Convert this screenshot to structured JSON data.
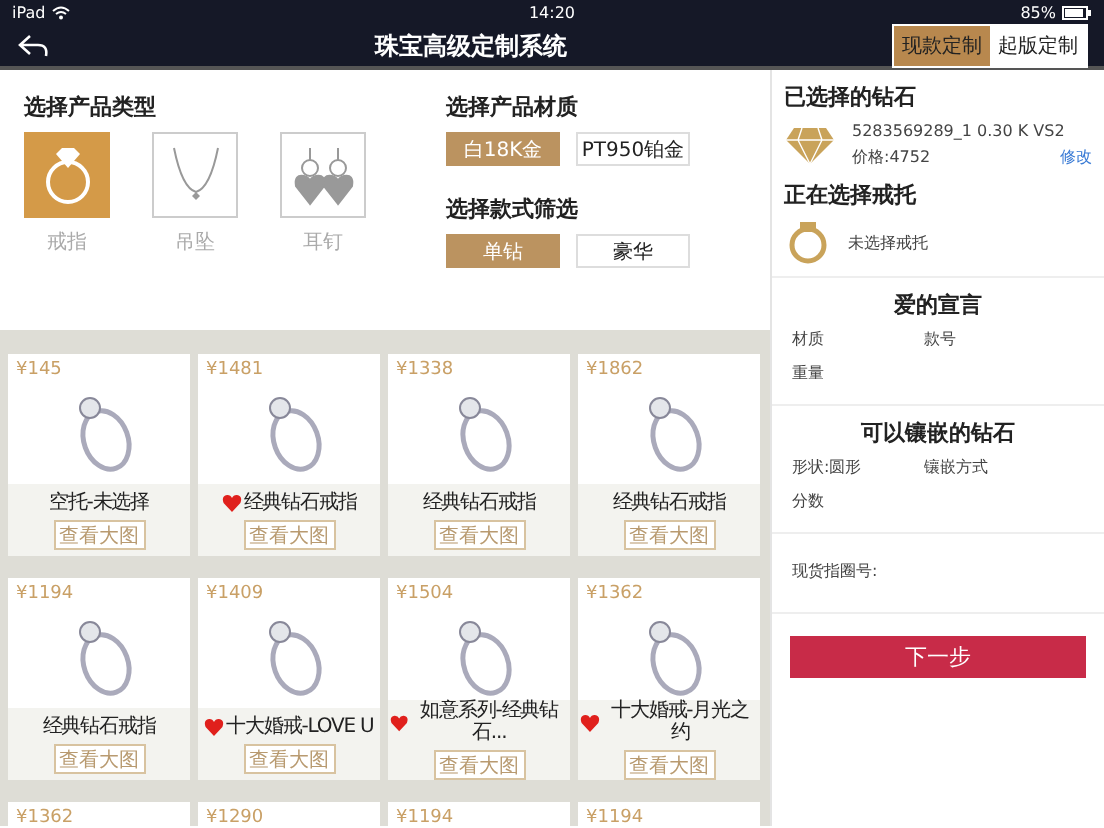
{
  "status_bar": {
    "device": "iPad",
    "time": "14:20",
    "battery": "85%"
  },
  "nav": {
    "title": "珠宝高级定制系统",
    "modes": [
      {
        "label": "现款定制",
        "selected": true
      },
      {
        "label": "起版定制",
        "selected": false
      }
    ]
  },
  "product_type": {
    "heading": "选择产品类型",
    "items": [
      {
        "kind": "ring",
        "label": "戒指",
        "selected": true
      },
      {
        "kind": "necklace",
        "label": "吊坠",
        "selected": false
      },
      {
        "kind": "earrings",
        "label": "耳钉",
        "selected": false
      }
    ]
  },
  "material": {
    "heading": "选择产品材质",
    "options": [
      {
        "label": "白18K金",
        "selected": true
      },
      {
        "label": "PT950铂金",
        "selected": false
      }
    ]
  },
  "style_filter": {
    "heading": "选择款式筛选",
    "options": [
      {
        "label": "单钻",
        "selected": true
      },
      {
        "label": "豪华",
        "selected": false
      }
    ]
  },
  "products": [
    {
      "price": "¥145",
      "name": "空托-未选择",
      "favorite": false,
      "button": "查看大图"
    },
    {
      "price": "¥1481",
      "name": "经典钻石戒指",
      "favorite": true,
      "button": "查看大图"
    },
    {
      "price": "¥1338",
      "name": "经典钻石戒指",
      "favorite": false,
      "button": "查看大图"
    },
    {
      "price": "¥1862",
      "name": "经典钻石戒指",
      "favorite": false,
      "button": "查看大图"
    },
    {
      "price": "¥1194",
      "name": "经典钻石戒指",
      "favorite": false,
      "button": "查看大图"
    },
    {
      "price": "¥1409",
      "name": "十大婚戒-LOVE U",
      "favorite": true,
      "button": "查看大图"
    },
    {
      "price": "¥1504",
      "name": "如意系列-经典钻石...",
      "favorite": true,
      "button": "查看大图"
    },
    {
      "price": "¥1362",
      "name": "十大婚戒-月光之约",
      "favorite": true,
      "button": "查看大图"
    },
    {
      "price": "¥1362"
    },
    {
      "price": "¥1290"
    },
    {
      "price": "¥1194"
    },
    {
      "price": "¥1194"
    }
  ],
  "side_panel": {
    "selected_diamond": {
      "heading": "已选择的钻石",
      "code": "5283569289_1 0.30 K VS2",
      "price": "价格:4752",
      "edit_link": "修改"
    },
    "selecting_setting": {
      "heading": "正在选择戒托",
      "status": "未选择戒托"
    },
    "love_declaration": {
      "heading": "爱的宣言",
      "fields": [
        [
          "材质",
          "款号"
        ],
        [
          "重量"
        ]
      ]
    },
    "settable_diamonds": {
      "heading": "可以镶嵌的钻石",
      "fields": [
        [
          "形状:圆形",
          "镶嵌方式"
        ],
        [
          "分数"
        ]
      ]
    },
    "stock_ring_size": {
      "label": "现货指圈号:"
    },
    "next_button": "下一步"
  }
}
